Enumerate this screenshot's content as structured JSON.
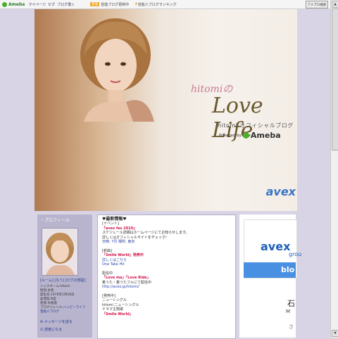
{
  "topbar": {
    "brand": "Ameba",
    "nav": [
      "マイページ",
      "ピグ",
      "ブログ書く"
    ],
    "promo_badge": "新着",
    "promo_text": "芸能ブログ更新中",
    "crown_text": "芸能人ブログランキング",
    "search_label": "アメブロ検索"
  },
  "header": {
    "title_name": "hitomi",
    "title_no": "の",
    "title_main": "Love Life",
    "subtitle": "hitomi オフィシャルブログ",
    "powered_by": "Powered by",
    "powered_brand": "Ameba",
    "avex_small": "avex"
  },
  "profile": {
    "heading": "プロフィール",
    "links": "[ルーム] [なう] [ピグの部屋]",
    "info": [
      "ニックネーム:hitomi",
      "性別:女性",
      "誕生日:1976年1月26日",
      "血液型:B型",
      "星座:水瓶座"
    ],
    "blog_genre_label": "ブログジャンル:",
    "blog_genre_value": "ハッピーライフ",
    "blog_genre_extra": "芸能人ブログ",
    "message_link": "メッセージを送る",
    "reader_link": "読者になる"
  },
  "entry": {
    "title": "♥最新情報♥",
    "events_label": "[イベント]",
    "event_name": "『avex fes 2010』",
    "event_lines": [
      "スケジュール詳細はホームページにてお知らせします。",
      "詳しくはオフィシャルサイトをチェック!",
      "日時: 7月 場所: 東京"
    ],
    "new_label": "[新曲]",
    "new_single": "「Smile World」発売中",
    "new_lines": [
      "詳しくはこちら",
      "One Take Hit"
    ],
    "dl_label": "配信中",
    "dl_song": "「Love me」「Love Ride」",
    "dl_lines": [
      "着うた・着うたフルにて配信中",
      "http://avex.jp/hitomi/"
    ],
    "release_label": "[発売中]",
    "release_sub": "ニューシングル",
    "release_lines": [
      "hitomi ニューシングル",
      "ドラマ主題歌"
    ],
    "release_song": "「Smile World」"
  },
  "sidebar_ad": {
    "brand": "avex",
    "brand_sub": "grou",
    "blog_tab": "blo",
    "text1": "石",
    "text2": "M",
    "text3": "さ"
  }
}
